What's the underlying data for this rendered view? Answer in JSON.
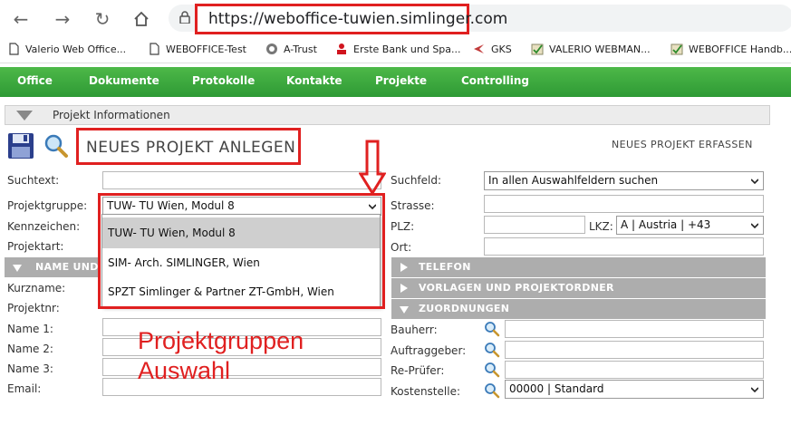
{
  "browser": {
    "url": "https://weboffice-tuwien.simlinger.com",
    "bookmarks": [
      {
        "label": "Valerio Web Office..."
      },
      {
        "label": "WEBOFFICE-Test"
      },
      {
        "label": "A-Trust"
      },
      {
        "label": "Erste Bank und Spa..."
      },
      {
        "label": "GKS"
      },
      {
        "label": "VALERIO WEBMAN..."
      },
      {
        "label": "WEBOFFICE Handb..."
      }
    ]
  },
  "menu": [
    "Office",
    "Dokumente",
    "Protokolle",
    "Kontakte",
    "Projekte",
    "Controlling"
  ],
  "panel": {
    "title": "Projekt Informationen",
    "page_title": "NEUES PROJEKT ANLEGEN",
    "action_link": "NEUES PROJEKT ERFASSEN"
  },
  "left_form": {
    "suchtext_label": "Suchtext:",
    "projektgruppe_label": "Projektgruppe:",
    "projektgruppe_value": "TUW- TU Wien, Modul 8",
    "kennzeichen_label": "Kennzeichen:",
    "projektart_label": "Projektart:",
    "section_name": "NAME UND",
    "kurzname_label": "Kurzname:",
    "projektnr_label": "Projektnr:",
    "name1_label": "Name 1:",
    "name2_label": "Name 2:",
    "name3_label": "Name 3:",
    "email_label": "Email:"
  },
  "dropdown_options": [
    "TUW- TU Wien, Modul 8",
    "SIM- Arch. SIMLINGER, Wien",
    "SPZT Simlinger & Partner ZT-GmbH, Wien"
  ],
  "right_form": {
    "suchfeld_label": "Suchfeld:",
    "suchfeld_value": "In allen Auswahlfeldern suchen",
    "strasse_label": "Strasse:",
    "plz_label": "PLZ:",
    "lkz_label": "LKZ:",
    "lkz_value": "A | Austria | +43",
    "ort_label": "Ort:",
    "section_telefon": "TELEFON",
    "section_vorlagen": "VORLAGEN UND PROJEKTORDNER",
    "section_zuordnungen": "ZUORDNUNGEN",
    "bauherr_label": "Bauherr:",
    "auftraggeber_label": "Auftraggeber:",
    "repruefer_label": "Re-Prüfer:",
    "kostenstelle_label": "Kostenstelle:",
    "kostenstelle_value": "00000 | Standard"
  },
  "annotation": {
    "line1": "Projektgruppen",
    "line2": "Auswahl"
  },
  "colors": {
    "menu_green": "#3aa83e",
    "highlight_red": "#e02020",
    "section_gray": "#adadad"
  }
}
